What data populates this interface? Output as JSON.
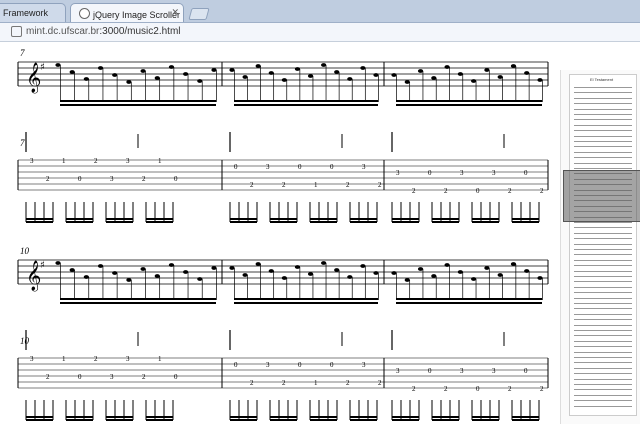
{
  "tabs": [
    {
      "label": "Framework",
      "active": false
    },
    {
      "label": "jQuery Image Scroller Plug",
      "active": true
    }
  ],
  "address_bar": {
    "host": "mint.dc.ufscar.br",
    "path": ":3000/music2.html"
  },
  "score": {
    "systems": [
      {
        "measure_number": "7",
        "tab_label": "7"
      },
      {
        "measure_number": "10",
        "tab_label": "10"
      }
    ]
  },
  "thumbnail": {
    "title": "El Testament"
  }
}
